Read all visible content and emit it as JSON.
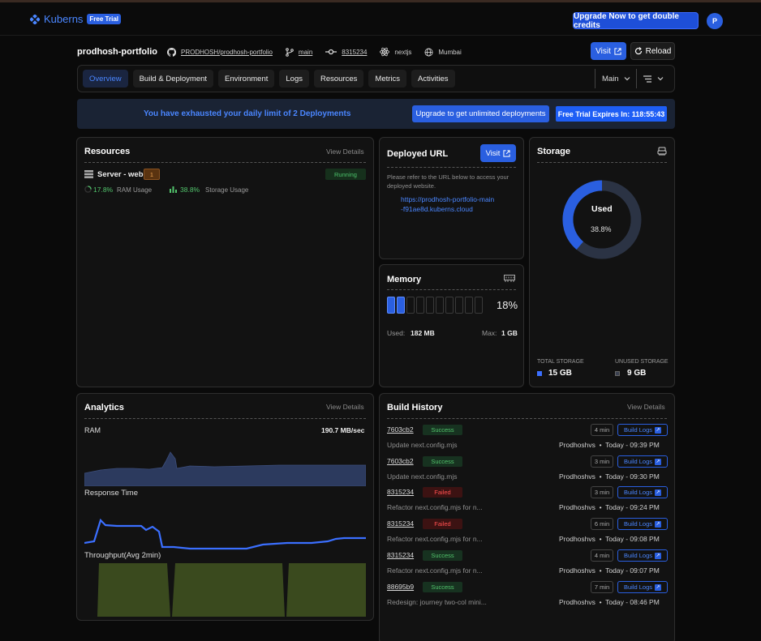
{
  "topbar": {
    "brand": "Kuberns",
    "free_badge": "Free Trial",
    "upgrade_button": "Upgrade Now to get double credits",
    "avatar_initial": "P"
  },
  "project": {
    "name": "prodhosh-portfolio",
    "repo": "PRODHOSH/prodhosh-portfolio",
    "branch": "main",
    "commit": "8315234",
    "framework": "nextjs",
    "region": "Mumbai",
    "visit_button": "Visit",
    "reload_button": "Reload"
  },
  "tabs": [
    "Overview",
    "Build & Deployment",
    "Environment",
    "Logs",
    "Resources",
    "Metrics",
    "Activities"
  ],
  "tab_right": {
    "env_select": "Main"
  },
  "banner": {
    "message": "You have exhausted your daily limit of 2 Deployments",
    "upgrade_button": "Upgrade to get unlimited deployments",
    "trial_button": "Free Trial Expires In: 118:55:43"
  },
  "resources": {
    "title": "Resources",
    "view_details": "View Details",
    "server_name": "Server - web",
    "server_count": "1",
    "status": "Running",
    "ram_value": "17.8%",
    "ram_label": "RAM Usage",
    "storage_value": "38.8%",
    "storage_label": "Storage Usage"
  },
  "deployed": {
    "title": "Deployed URL",
    "visit_button": "Visit",
    "description": "Please refer to the URL below to access your deployed website.",
    "url_line1": "https://prodhosh-portfolio-main",
    "url_line2": "-f91ae8d.kuberns.cloud"
  },
  "memory": {
    "title": "Memory",
    "percent": "18%",
    "fill_fraction": 0.18,
    "used_label": "Used:",
    "used_value": "182 MB",
    "max_label": "Max:",
    "max_value": "1 GB"
  },
  "storage": {
    "title": "Storage",
    "center_label": "Used",
    "center_value": "38.8%",
    "used_fraction": 0.388,
    "total_label": "TOTAL STORAGE",
    "total_value": "15 GB",
    "unused_label": "UNUSED STORAGE",
    "unused_value": "9 GB",
    "colors": {
      "used": "#2a5fe0",
      "unused": "#2b3344"
    }
  },
  "analytics": {
    "title": "Analytics",
    "view_details": "View Details",
    "ram_label": "RAM",
    "ram_value": "190.7 MB/sec",
    "response_label": "Response Time",
    "throughput_label": "Throughput(Avg 2min)"
  },
  "build_history": {
    "title": "Build History",
    "view_details": "View Details",
    "logs_label": "Build Logs",
    "rows": [
      {
        "commit": "7603cb2",
        "status": "Success",
        "duration": "4 min",
        "message": "Update next.config.mjs",
        "author": "Prodhoshvs",
        "time": "Today - 09:39 PM"
      },
      {
        "commit": "7603cb2",
        "status": "Success",
        "duration": "3 min",
        "message": "Update next.config.mjs",
        "author": "Prodhoshvs",
        "time": "Today - 09:30 PM"
      },
      {
        "commit": "8315234",
        "status": "Failed",
        "duration": "3 min",
        "message": "Refactor next.config.mjs for n...",
        "author": "Prodhoshvs",
        "time": "Today - 09:24 PM"
      },
      {
        "commit": "8315234",
        "status": "Failed",
        "duration": "6 min",
        "message": "Refactor next.config.mjs for n...",
        "author": "Prodhoshvs",
        "time": "Today - 09:08 PM"
      },
      {
        "commit": "8315234",
        "status": "Success",
        "duration": "4 min",
        "message": "Refactor next.config.mjs for n...",
        "author": "Prodhoshvs",
        "time": "Today - 09:07 PM"
      },
      {
        "commit": "88695b9",
        "status": "Success",
        "duration": "7 min",
        "message": "Redesign: journey two-col mini...",
        "author": "Prodhoshvs",
        "time": "Today - 08:46 PM"
      }
    ]
  }
}
